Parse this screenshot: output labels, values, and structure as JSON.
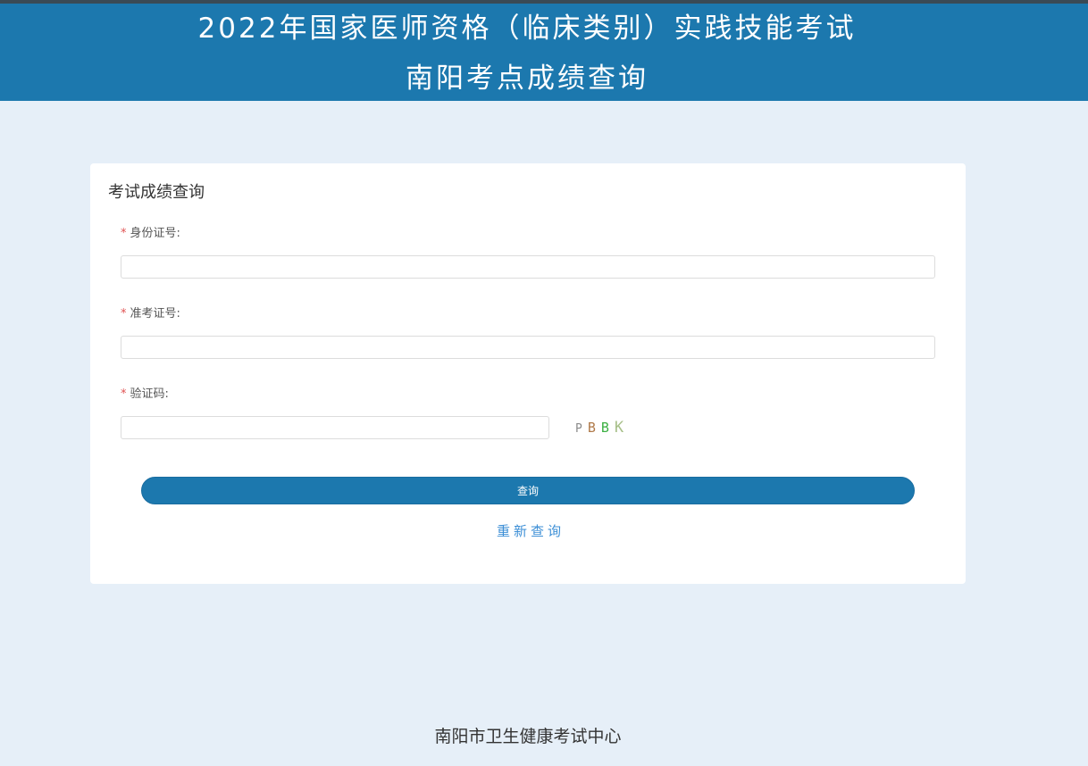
{
  "header": {
    "title_line1": "2022年国家医师资格（临床类别）实践技能考试",
    "title_line2": "南阳考点成绩查询"
  },
  "form": {
    "title": "考试成绩查询",
    "required_mark": "*",
    "id_label": "身份证号:",
    "id_value": "",
    "ticket_label": "准考证号:",
    "ticket_value": "",
    "captcha_label": "验证码:",
    "captcha_value": "",
    "captcha_chars": [
      {
        "char": "P",
        "color": "#8a8a8a"
      },
      {
        "char": "B",
        "color": "#b07a4a"
      },
      {
        "char": "B",
        "color": "#3cb043"
      },
      {
        "char": "K",
        "color": "#a8c08a"
      }
    ],
    "submit_label": "查询",
    "reset_label": "重新查询"
  },
  "footer": {
    "text": "南阳市卫生健康考试中心"
  },
  "colors": {
    "header_bg": "#1c78ae",
    "page_bg": "#e6eff8",
    "link": "#3d8fd6",
    "required": "#e05252"
  }
}
